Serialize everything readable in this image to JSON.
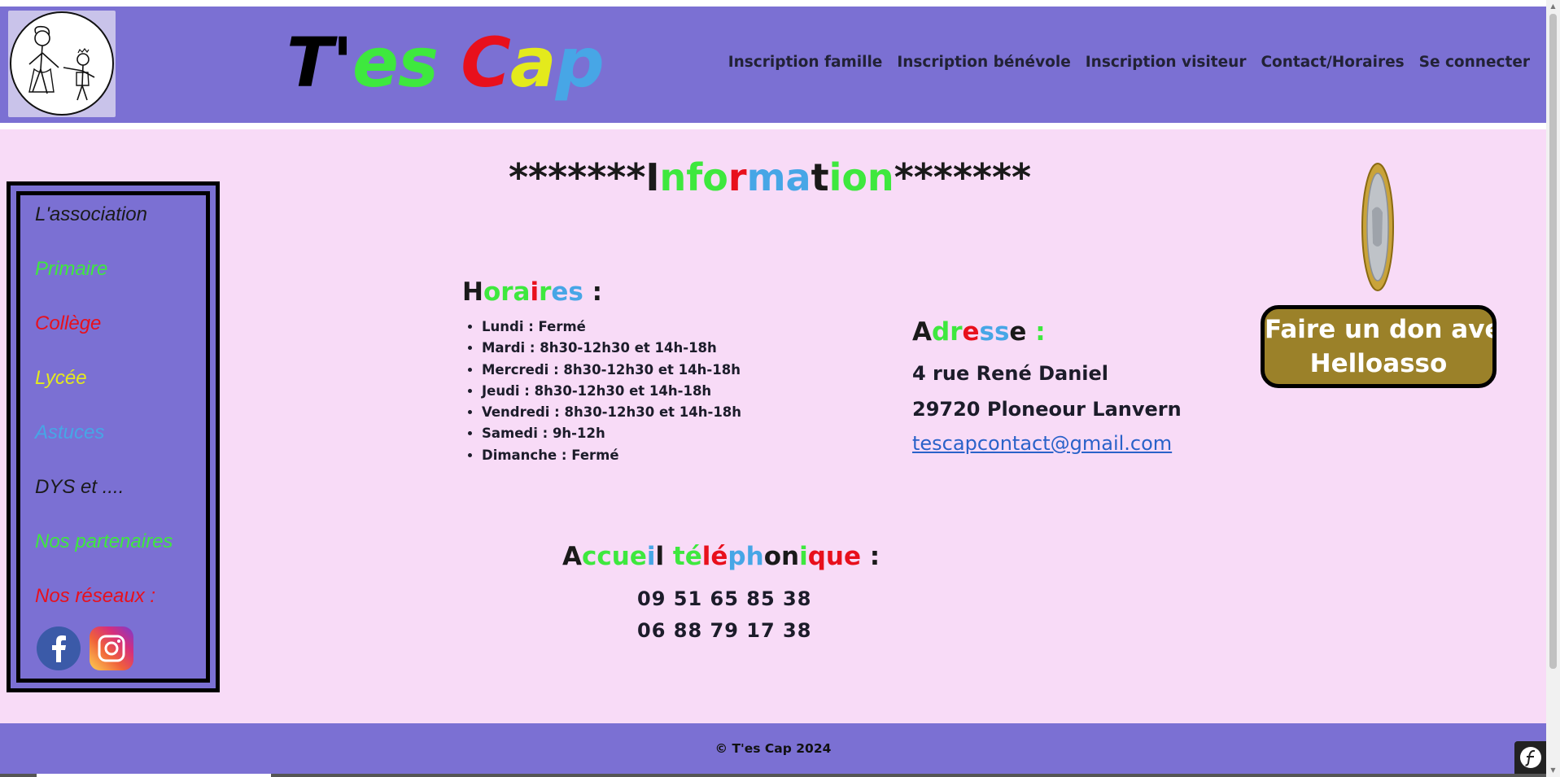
{
  "header": {
    "brand": [
      {
        "text": "T'",
        "color": "#000000"
      },
      {
        "text": "es ",
        "color": "#3ee83e"
      },
      {
        "text": "C",
        "color": "#e8101c"
      },
      {
        "text": "a",
        "color": "#e4ea1c"
      },
      {
        "text": "p",
        "color": "#47a6e6"
      }
    ],
    "nav": [
      "Inscription famille",
      "Inscription bénévole",
      "Inscription visiteur",
      "Contact/Horaires",
      "Se connecter"
    ]
  },
  "sidebar": {
    "items": [
      {
        "label": "L'association",
        "color": "#1a1a1a"
      },
      {
        "label": "Primaire",
        "color": "#3ee83e"
      },
      {
        "label": "Collège",
        "color": "#e8101c"
      },
      {
        "label": "Lycée",
        "color": "#e4ea1c"
      },
      {
        "label": "Astuces",
        "color": "#47a6e6"
      },
      {
        "label": "DYS et ....",
        "color": "#1a1a1a"
      },
      {
        "label": "Nos partenaires",
        "color": "#3ee83e"
      },
      {
        "label": "Nos réseaux :",
        "color": "#e8101c"
      }
    ],
    "social": [
      "facebook-icon",
      "instagram-icon"
    ]
  },
  "info_title": [
    {
      "text": "*******I",
      "color": "#1a1a1a"
    },
    {
      "text": "nfo",
      "color": "#3ee83e"
    },
    {
      "text": "r",
      "color": "#e8101c"
    },
    {
      "text": "ma",
      "color": "#47a6e6"
    },
    {
      "text": "t",
      "color": "#1a1a1a"
    },
    {
      "text": "ion",
      "color": "#3ee83e"
    },
    {
      "text": "*******",
      "color": "#1a1a1a"
    }
  ],
  "horaires": {
    "title": [
      {
        "text": "H",
        "color": "#1a1a1a"
      },
      {
        "text": "ora",
        "color": "#3ee83e"
      },
      {
        "text": "i",
        "color": "#e8101c"
      },
      {
        "text": "r",
        "color": "#3ee83e"
      },
      {
        "text": "es",
        "color": "#47a6e6"
      },
      {
        "text": " :",
        "color": "#1a1a1a"
      }
    ],
    "items": [
      "Lundi : Fermé",
      "Mardi : 8h30-12h30 et 14h-18h",
      "Mercredi : 8h30-12h30 et 14h-18h",
      "Jeudi : 8h30-12h30 et 14h-18h",
      "Vendredi : 8h30-12h30 et 14h-18h",
      "Samedi : 9h-12h",
      "Dimanche : Fermé"
    ]
  },
  "adresse": {
    "title": [
      {
        "text": "A",
        "color": "#1a1a1a"
      },
      {
        "text": "dr",
        "color": "#3ee83e"
      },
      {
        "text": "e",
        "color": "#e8101c"
      },
      {
        "text": "ss",
        "color": "#47a6e6"
      },
      {
        "text": "e",
        "color": "#1a1a1a"
      },
      {
        "text": " :",
        "color": "#3ee83e"
      }
    ],
    "street": "4 rue René Daniel",
    "city": "29720 Ploneour Lanvern",
    "email": "tescapcontact@gmail.com"
  },
  "accueil": {
    "title": [
      {
        "text": "A",
        "color": "#1a1a1a"
      },
      {
        "text": "ccue",
        "color": "#3ee83e"
      },
      {
        "text": "i",
        "color": "#47a6e6"
      },
      {
        "text": "l ",
        "color": "#1a1a1a"
      },
      {
        "text": "té",
        "color": "#3ee83e"
      },
      {
        "text": "lé",
        "color": "#e8101c"
      },
      {
        "text": "ph",
        "color": "#47a6e6"
      },
      {
        "text": "on",
        "color": "#1a1a1a"
      },
      {
        "text": "i",
        "color": "#3ee83e"
      },
      {
        "text": "que",
        "color": "#e8101c"
      },
      {
        "text": " :",
        "color": "#1a1a1a"
      }
    ],
    "phones": [
      "09 51 65 85 38",
      "06 88 79 17 38"
    ]
  },
  "donation": {
    "line1": "Faire un don avec",
    "line2": "Helloasso",
    "icon": "coin-icon"
  },
  "footer": {
    "text": "© T'es Cap 2024"
  },
  "colors": {
    "header_bg": "#7b70d3",
    "main_bg": "#f8dbf7",
    "donate_bg": "#9b8129"
  }
}
